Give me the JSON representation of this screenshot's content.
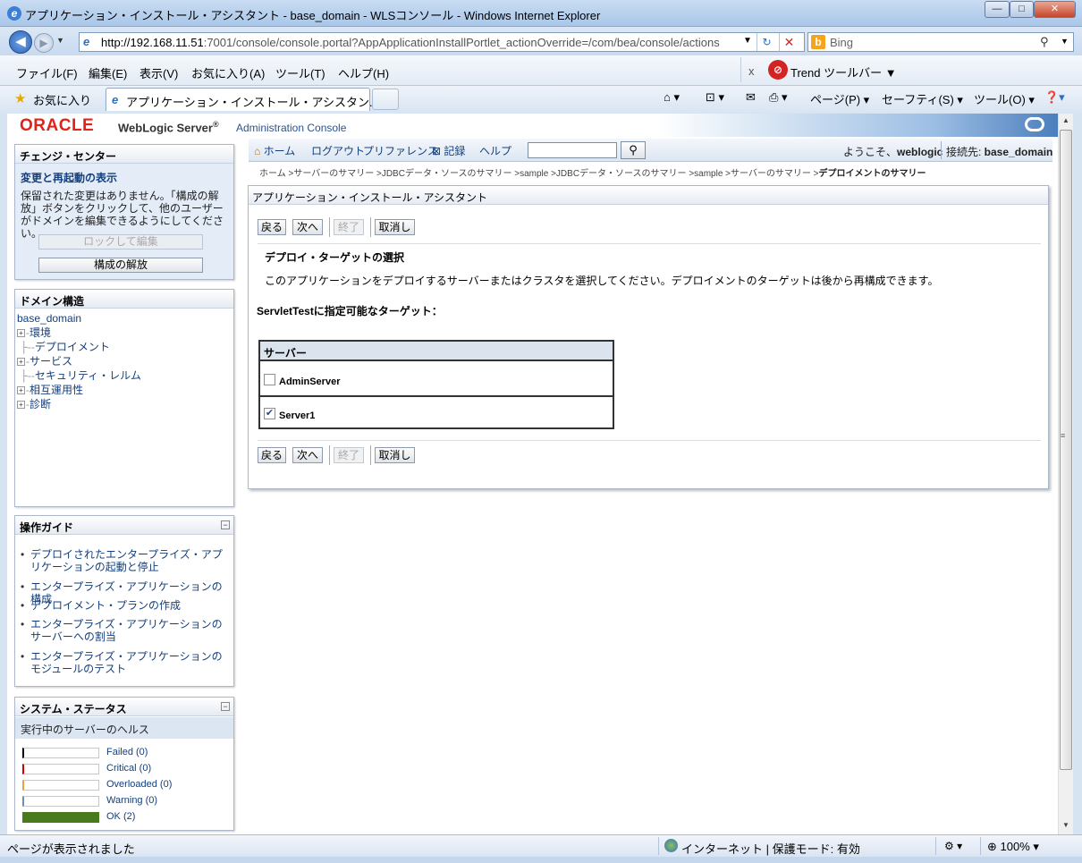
{
  "window": {
    "title": "アプリケーション・インストール・アシスタント - base_domain - WLSコンソール - Windows Internet Explorer",
    "min_glyph": "—",
    "max_glyph": "□",
    "close_glyph": "✕"
  },
  "address": {
    "url_host": "http://192.168.11.51",
    "url_rest": ":7001/console/console.portal?AppApplicationInstallPortlet_actionOverride=/com/bea/console/actions"
  },
  "search": {
    "placeholder": "Bing"
  },
  "menu": {
    "items": [
      "ファイル(F)",
      "編集(E)",
      "表示(V)",
      "お気に入り(A)",
      "ツール(T)",
      "ヘルプ(H)"
    ],
    "trend": "Trend ツールバー ▼"
  },
  "favorites": {
    "label": "お気に入り",
    "tab_label": "アプリケーション・インストール・アシスタン...",
    "commands": [
      "ページ(P) ▾",
      "セーフティ(S) ▾",
      "ツール(O) ▾"
    ]
  },
  "header": {
    "logo": "ORACLE",
    "product": "WebLogic Server",
    "reg": "®",
    "sub": "Administration Console"
  },
  "change_center": {
    "title": "チェンジ・センター",
    "view_link": "変更と再起動の表示",
    "message": "保留された変更はありません。「構成の解放」ボタンをクリックして、他のユーザーがドメインを編集できるようにしてください。",
    "lock_button": "ロックして編集",
    "release_button": "構成の解放"
  },
  "domain_structure": {
    "title": "ドメイン構造",
    "root": "base_domain",
    "nodes": [
      "環境",
      "デプロイメント",
      "サービス",
      "セキュリティ・レルム",
      "相互運用性",
      "診断"
    ]
  },
  "guide": {
    "title": "操作ガイド",
    "items": [
      "デプロイされたエンタープライズ・アプリケーションの起動と停止",
      "エンタープライズ・アプリケーションの構成",
      "デプロイメント・プランの作成",
      "エンタープライズ・アプリケーションのサーバーへの割当",
      "エンタープライズ・アプリケーションのモジュールのテスト"
    ]
  },
  "system_status": {
    "title": "システム・ステータス",
    "health_title": "実行中のサーバーのヘルス",
    "rows": [
      {
        "label": "Failed (0)",
        "color": "#000000",
        "fraction": 0
      },
      {
        "label": "Critical (0)",
        "color": "#d40000",
        "fraction": 0
      },
      {
        "label": "Overloaded (0)",
        "color": "#e8a33c",
        "fraction": 0
      },
      {
        "label": "Warning (0)",
        "color": "#6f8fb5",
        "fraction": 0
      },
      {
        "label": "OK (2)",
        "color": "#4a7a1e",
        "fraction": 1
      }
    ]
  },
  "topnav": {
    "home": "ホーム",
    "logout": "ログアウト",
    "prefs": "プリファレンス",
    "record": "記録",
    "help": "ヘルプ",
    "search_value": "",
    "welcome_prefix": "ようこそ、",
    "user": "weblogic",
    "conn_prefix": "接続先: ",
    "domain": "base_domain"
  },
  "breadcrumb": {
    "trail": "ホーム >サーバーのサマリー >JDBCデータ・ソースのサマリー >sample >JDBCデータ・ソースのサマリー >sample >サーバーのサマリー >",
    "current": "デプロイメントのサマリー"
  },
  "assistant": {
    "title": "アプリケーション・インストール・アシスタント",
    "buttons": {
      "back": "戻る",
      "next": "次へ",
      "finish": "終了",
      "cancel": "取消し"
    },
    "section_title": "デプロイ・ターゲットの選択",
    "description": "このアプリケーションをデプロイするサーバーまたはクラスタを選択してください。デプロイメントのターゲットは後から再構成できます。",
    "targets_label": "ServletTestに指定可能なターゲット：",
    "table_header": "サーバー",
    "servers": [
      {
        "name": "AdminServer",
        "checked": false
      },
      {
        "name": "Server1",
        "checked": true
      }
    ]
  },
  "statusbar": {
    "text": "ページが表示されました",
    "zone": "インターネット | 保護モード: 有効",
    "zoom": "100%"
  }
}
